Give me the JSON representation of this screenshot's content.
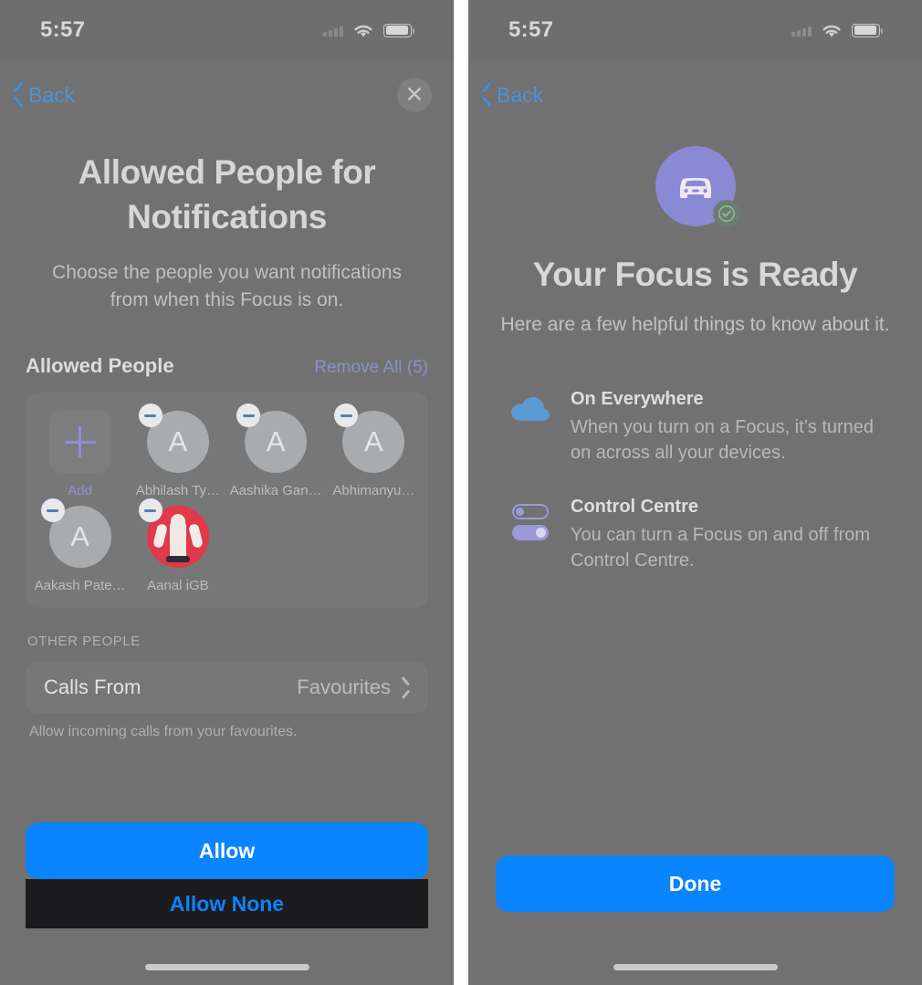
{
  "left": {
    "status": {
      "time": "5:57"
    },
    "nav": {
      "back_label": "Back",
      "close_label": "✕"
    },
    "hero": {
      "title": "Allowed People for Notifications",
      "subtitle": "Choose the people you want notifications from when this Focus is on."
    },
    "section": {
      "title": "Allowed People",
      "action_label": "Remove All (5)"
    },
    "people": [
      {
        "name": "Add",
        "kind": "add"
      },
      {
        "name": "Abhilash Ty…",
        "initial": "A",
        "kind": "initial"
      },
      {
        "name": "Aashika Gan…",
        "initial": "A",
        "kind": "initial"
      },
      {
        "name": "Abhimanyu…",
        "initial": "A",
        "kind": "initial"
      },
      {
        "name": "Aakash Pate…",
        "initial": "A",
        "kind": "initial"
      },
      {
        "name": "Aanal iGB",
        "kind": "photo"
      }
    ],
    "other": {
      "group_label": "OTHER PEOPLE",
      "row_label": "Calls From",
      "row_value": "Favourites",
      "footnote": "Allow incoming calls from your favourites."
    },
    "buttons": {
      "primary": "Allow",
      "secondary": "Allow None"
    }
  },
  "right": {
    "status": {
      "time": "5:57"
    },
    "nav": {
      "back_label": "Back"
    },
    "hero": {
      "icon_name": "car-icon",
      "title": "Your Focus is Ready",
      "subtitle": "Here are a few helpful things to know about it."
    },
    "features": [
      {
        "icon": "cloud-icon",
        "title": "On Everywhere",
        "body": "When you turn on a Focus, it’s turned on across all your devices."
      },
      {
        "icon": "toggles-icon",
        "title": "Control Centre",
        "body": "You can turn a Focus on and off from Control Centre."
      }
    ],
    "buttons": {
      "primary": "Done"
    }
  },
  "colors": {
    "accent_blue": "#0a84ff",
    "link_blue": "#4c93d8",
    "purple": "#8a8ad4",
    "cloud_blue": "#5a9bd4",
    "screen_bg": "#717171",
    "green_check": "#7cb08a"
  }
}
